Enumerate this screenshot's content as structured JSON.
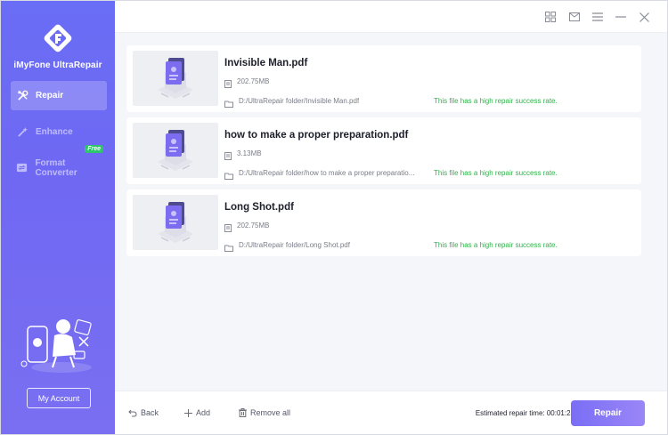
{
  "sidebar": {
    "brand": "iMyFone UltraRepair",
    "items": [
      {
        "label": "Repair",
        "active": true
      },
      {
        "label": "Enhance",
        "active": false
      },
      {
        "label": "Format Converter",
        "active": false,
        "badge": "Free"
      }
    ],
    "account_label": "My Account"
  },
  "files": [
    {
      "name": "Invisible Man.pdf",
      "size": "202.75MB",
      "path": "D:/UltraRepair folder/Invisible Man.pdf",
      "status": "This file has a high repair success rate."
    },
    {
      "name": "how to make a proper preparation.pdf",
      "size": "3.13MB",
      "path": "D:/UltraRepair folder/how to make a proper preparatio...",
      "status": "This file has a high repair success rate."
    },
    {
      "name": "Long Shot.pdf",
      "size": "202.75MB",
      "path": "D:/UltraRepair folder/Long Shot.pdf",
      "status": "This file has a high repair success rate."
    }
  ],
  "footer": {
    "back_label": "Back",
    "add_label": "Add",
    "remove_label": "Remove all",
    "estimate_label": "Estimated repair time: 00:01:23",
    "repair_label": "Repair"
  },
  "colors": {
    "accent": "#6c6cf4",
    "success": "#2fb24a",
    "badge": "#2fc56b"
  }
}
